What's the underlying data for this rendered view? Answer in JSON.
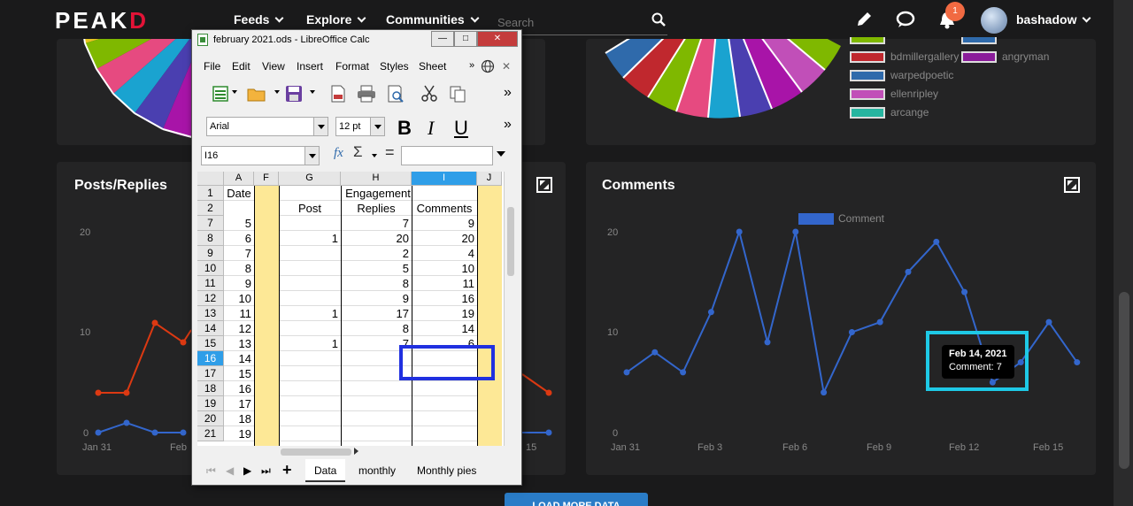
{
  "nav": {
    "logo_main": "PEAK",
    "logo_accent": "D",
    "links": [
      "Feeds",
      "Explore",
      "Communities"
    ],
    "search_placeholder": "Search",
    "notification_count": "1",
    "username": "bashadow"
  },
  "legend_right": {
    "items": [
      {
        "label": "bdmillergallery",
        "color": "#c0282e"
      },
      {
        "label": "warpedpoetic",
        "color": "#2f6aab"
      },
      {
        "label": "ellenripley",
        "color": "#c14fb8"
      },
      {
        "label": "arcange",
        "color": "#26b5a0"
      },
      {
        "label": "angryman",
        "color": "#8a1c9a"
      }
    ]
  },
  "posts_card": {
    "title": "Posts/Replies",
    "y_ticks": [
      "20",
      "10",
      "0"
    ],
    "x_ticks": [
      "Jan 31",
      "Feb",
      "15"
    ]
  },
  "comments_card": {
    "title": "Comments",
    "legend": "Comment",
    "y_ticks": [
      "20",
      "10",
      "0"
    ],
    "x_ticks": [
      "Jan 31",
      "Feb 3",
      "Feb 6",
      "Feb 9",
      "Feb 12",
      "Feb 15"
    ]
  },
  "tooltip": {
    "date": "Feb 14, 2021",
    "value": "Comment: 7"
  },
  "load_more": "LOAD MORE DATA",
  "calc": {
    "window_title": "february 2021.ods - LibreOffice Calc",
    "menu": [
      "File",
      "Edit",
      "View",
      "Insert",
      "Format",
      "Styles",
      "Sheet"
    ],
    "font_name": "Arial",
    "font_size": "12 pt",
    "name_box": "I16",
    "col_headers": [
      "A",
      "F",
      "G",
      "H",
      "I",
      "J"
    ],
    "row1": {
      "num": "1",
      "A": "Date",
      "merged": "Engagement"
    },
    "row2": {
      "num": "2",
      "G": "Post",
      "H": "Replies",
      "I": "Comments"
    },
    "rows": [
      {
        "num": "7",
        "A": "5",
        "G": "",
        "H": "7",
        "I": "9"
      },
      {
        "num": "8",
        "A": "6",
        "G": "1",
        "H": "20",
        "I": "20"
      },
      {
        "num": "9",
        "A": "7",
        "G": "",
        "H": "2",
        "I": "4"
      },
      {
        "num": "10",
        "A": "8",
        "G": "",
        "H": "5",
        "I": "10"
      },
      {
        "num": "11",
        "A": "9",
        "G": "",
        "H": "8",
        "I": "11"
      },
      {
        "num": "12",
        "A": "10",
        "G": "",
        "H": "9",
        "I": "16"
      },
      {
        "num": "13",
        "A": "11",
        "G": "1",
        "H": "17",
        "I": "19"
      },
      {
        "num": "14",
        "A": "12",
        "G": "",
        "H": "8",
        "I": "14"
      },
      {
        "num": "15",
        "A": "13",
        "G": "1",
        "H": "7",
        "I": "6"
      },
      {
        "num": "16",
        "A": "14",
        "G": "",
        "H": "",
        "I": ""
      },
      {
        "num": "17",
        "A": "15",
        "G": "",
        "H": "",
        "I": ""
      },
      {
        "num": "18",
        "A": "16",
        "G": "",
        "H": "",
        "I": ""
      },
      {
        "num": "19",
        "A": "17",
        "G": "",
        "H": "",
        "I": ""
      },
      {
        "num": "20",
        "A": "18",
        "G": "",
        "H": "",
        "I": ""
      },
      {
        "num": "21",
        "A": "19",
        "G": "",
        "H": "",
        "I": ""
      }
    ],
    "sheets": [
      "Data",
      "monthly",
      "Monthly pies"
    ]
  },
  "colors": {
    "accent_red": "#e31337",
    "line_blue": "#3366cc",
    "line_orange": "#dc3912",
    "tooltip_border": "#1ec9e6",
    "highlight_box": "#2030e0"
  },
  "chart_data": {
    "type": "line",
    "title": "Comments",
    "series": [
      {
        "name": "Comment",
        "values": [
          6,
          8,
          6,
          12,
          20,
          9,
          20,
          4,
          10,
          11,
          16,
          19,
          14,
          5,
          7,
          11,
          7
        ]
      }
    ],
    "ylim": [
      0,
      20
    ]
  }
}
